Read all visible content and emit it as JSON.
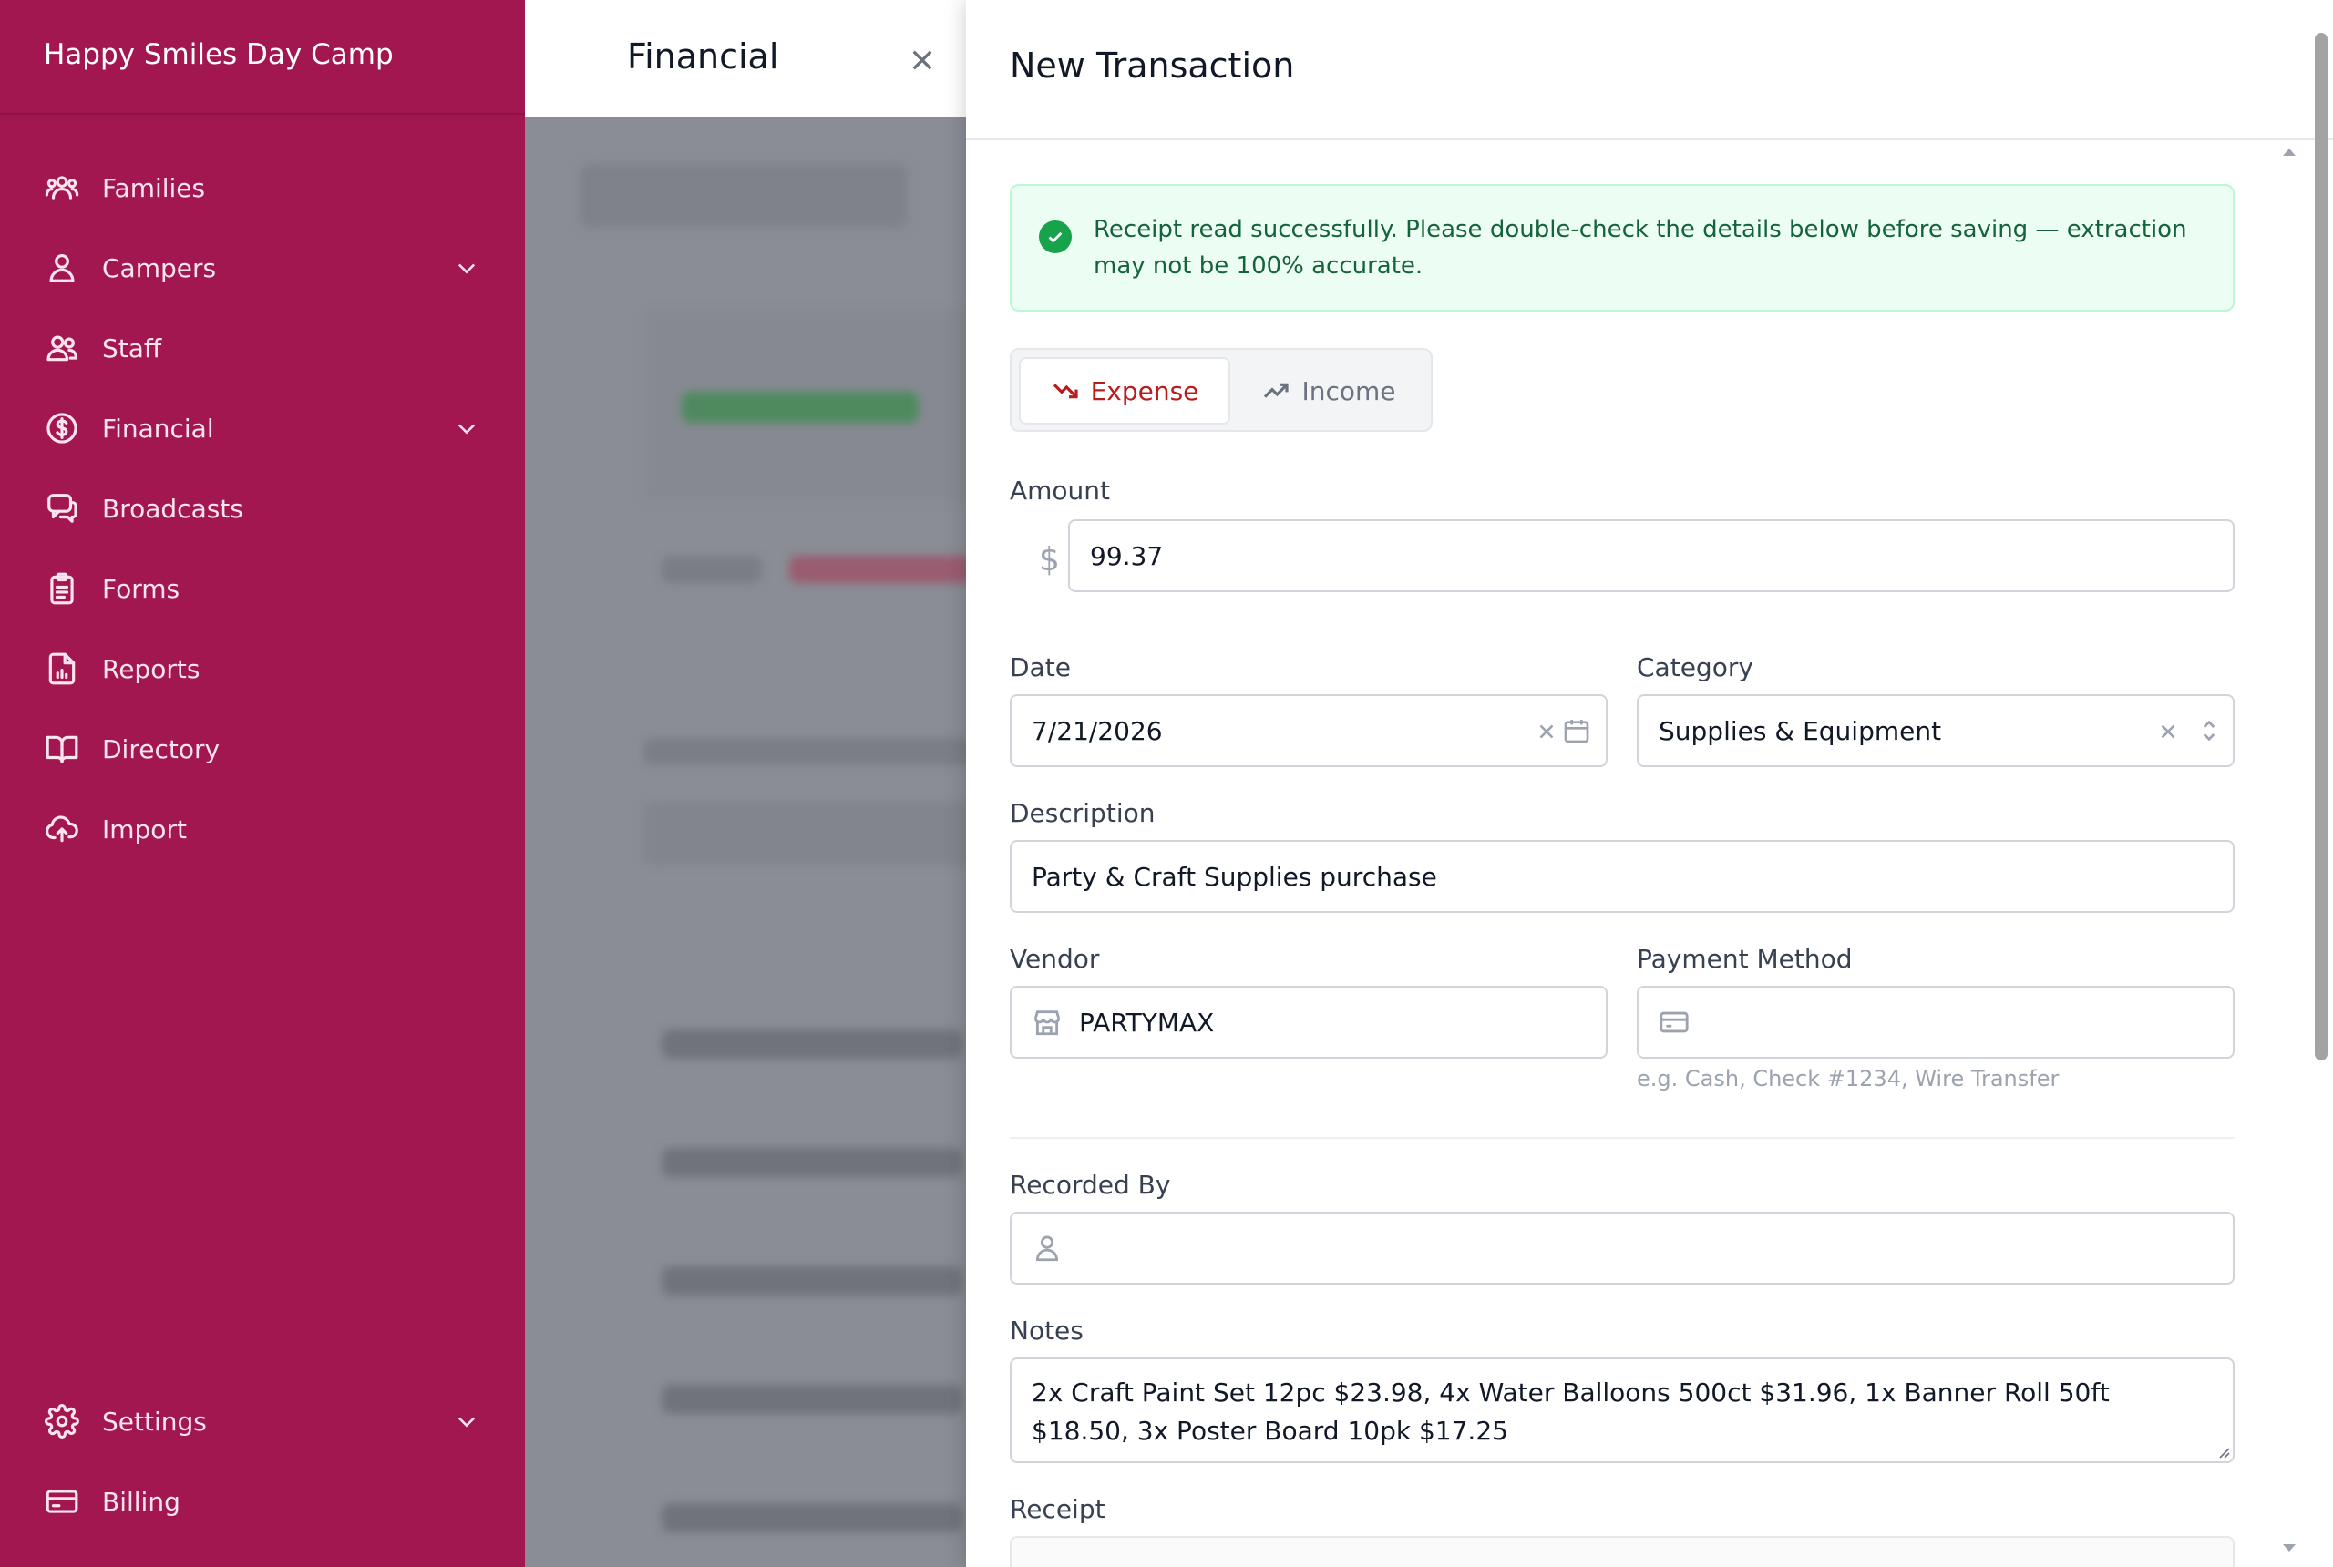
{
  "app": {
    "name": "Happy Smiles Day Camp"
  },
  "sidebar": {
    "items": [
      {
        "label": "Families",
        "icon": "families-icon"
      },
      {
        "label": "Campers",
        "icon": "person-icon",
        "expandable": true
      },
      {
        "label": "Staff",
        "icon": "staff-icon"
      },
      {
        "label": "Financial",
        "icon": "dollar-circle-icon",
        "expandable": true
      },
      {
        "label": "Broadcasts",
        "icon": "chat-icon"
      },
      {
        "label": "Forms",
        "icon": "clipboard-icon"
      },
      {
        "label": "Reports",
        "icon": "report-icon"
      },
      {
        "label": "Directory",
        "icon": "book-icon"
      },
      {
        "label": "Import",
        "icon": "cloud-upload-icon"
      }
    ],
    "bottom_items": [
      {
        "label": "Settings",
        "icon": "gear-icon",
        "expandable": true
      },
      {
        "label": "Billing",
        "icon": "card-icon"
      }
    ]
  },
  "background": {
    "title": "Financial"
  },
  "panel": {
    "title": "New Transaction",
    "alert": "Receipt read successfully. Please double-check the details below before saving — extraction may not be 100% accurate.",
    "type_toggle": {
      "expense": "Expense",
      "income": "Income",
      "selected": "Expense"
    },
    "amount": {
      "label": "Amount",
      "currency": "$",
      "value": "99.37"
    },
    "date": {
      "label": "Date",
      "value": "7/21/2026"
    },
    "category": {
      "label": "Category",
      "value": "Supplies & Equipment"
    },
    "description": {
      "label": "Description",
      "value": "Party & Craft Supplies purchase"
    },
    "vendor": {
      "label": "Vendor",
      "value": "PARTYMAX"
    },
    "payment_method": {
      "label": "Payment Method",
      "value": "",
      "help": "e.g. Cash, Check #1234, Wire Transfer"
    },
    "recorded_by": {
      "label": "Recorded By",
      "value": ""
    },
    "notes": {
      "label": "Notes",
      "value": "2x Craft Paint Set 12pc $23.98, 4x Water Balloons 500ct $31.96, 1x Banner Roll 50ft $18.50, 3x Poster Board 10pk $17.25"
    },
    "receipt": {
      "label": "Receipt"
    }
  },
  "colors": {
    "sidebar": "#a21750",
    "accent": "#b91c1c",
    "success": "#16a34a"
  }
}
